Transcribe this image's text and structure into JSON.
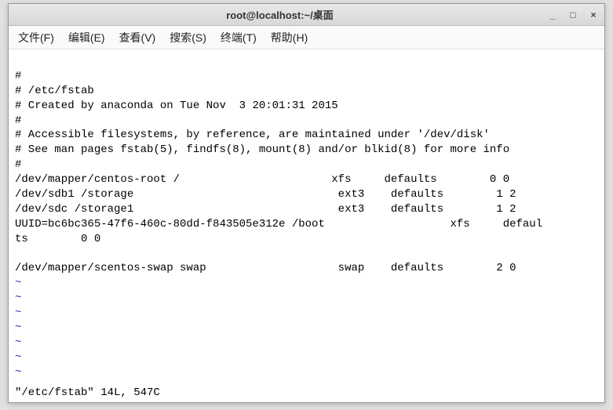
{
  "window": {
    "title": "root@localhost:~/桌面"
  },
  "menu": {
    "file": "文件(F)",
    "edit": "编辑(E)",
    "view": "查看(V)",
    "search": "搜索(S)",
    "terminal": "终端(T)",
    "help": "帮助(H)"
  },
  "content": {
    "l0": "#",
    "l1": "# /etc/fstab",
    "l2": "# Created by anaconda on Tue Nov  3 20:01:31 2015",
    "l3": "#",
    "l4": "# Accessible filesystems, by reference, are maintained under '/dev/disk'",
    "l5": "# See man pages fstab(5), findfs(8), mount(8) and/or blkid(8) for more info",
    "l6": "#",
    "l7": "/dev/mapper/centos-root /                       xfs     defaults        0 0",
    "l8": "/dev/sdb1 /storage                               ext3    defaults        1 2",
    "l9": "/dev/sdc /storage1                               ext3    defaults        1 2",
    "l10": "UUID=bc6bc365-47f6-460c-80dd-f843505e312e /boot                   xfs     defaul",
    "l11": "ts        0 0",
    "l12": "",
    "l13": "/dev/mapper/scentos-swap swap                    swap    defaults        2 0"
  },
  "tilde": "~",
  "status": "\"/etc/fstab\" 14L, 547C",
  "winctl": {
    "min": "_",
    "max": "□",
    "close": "×"
  }
}
